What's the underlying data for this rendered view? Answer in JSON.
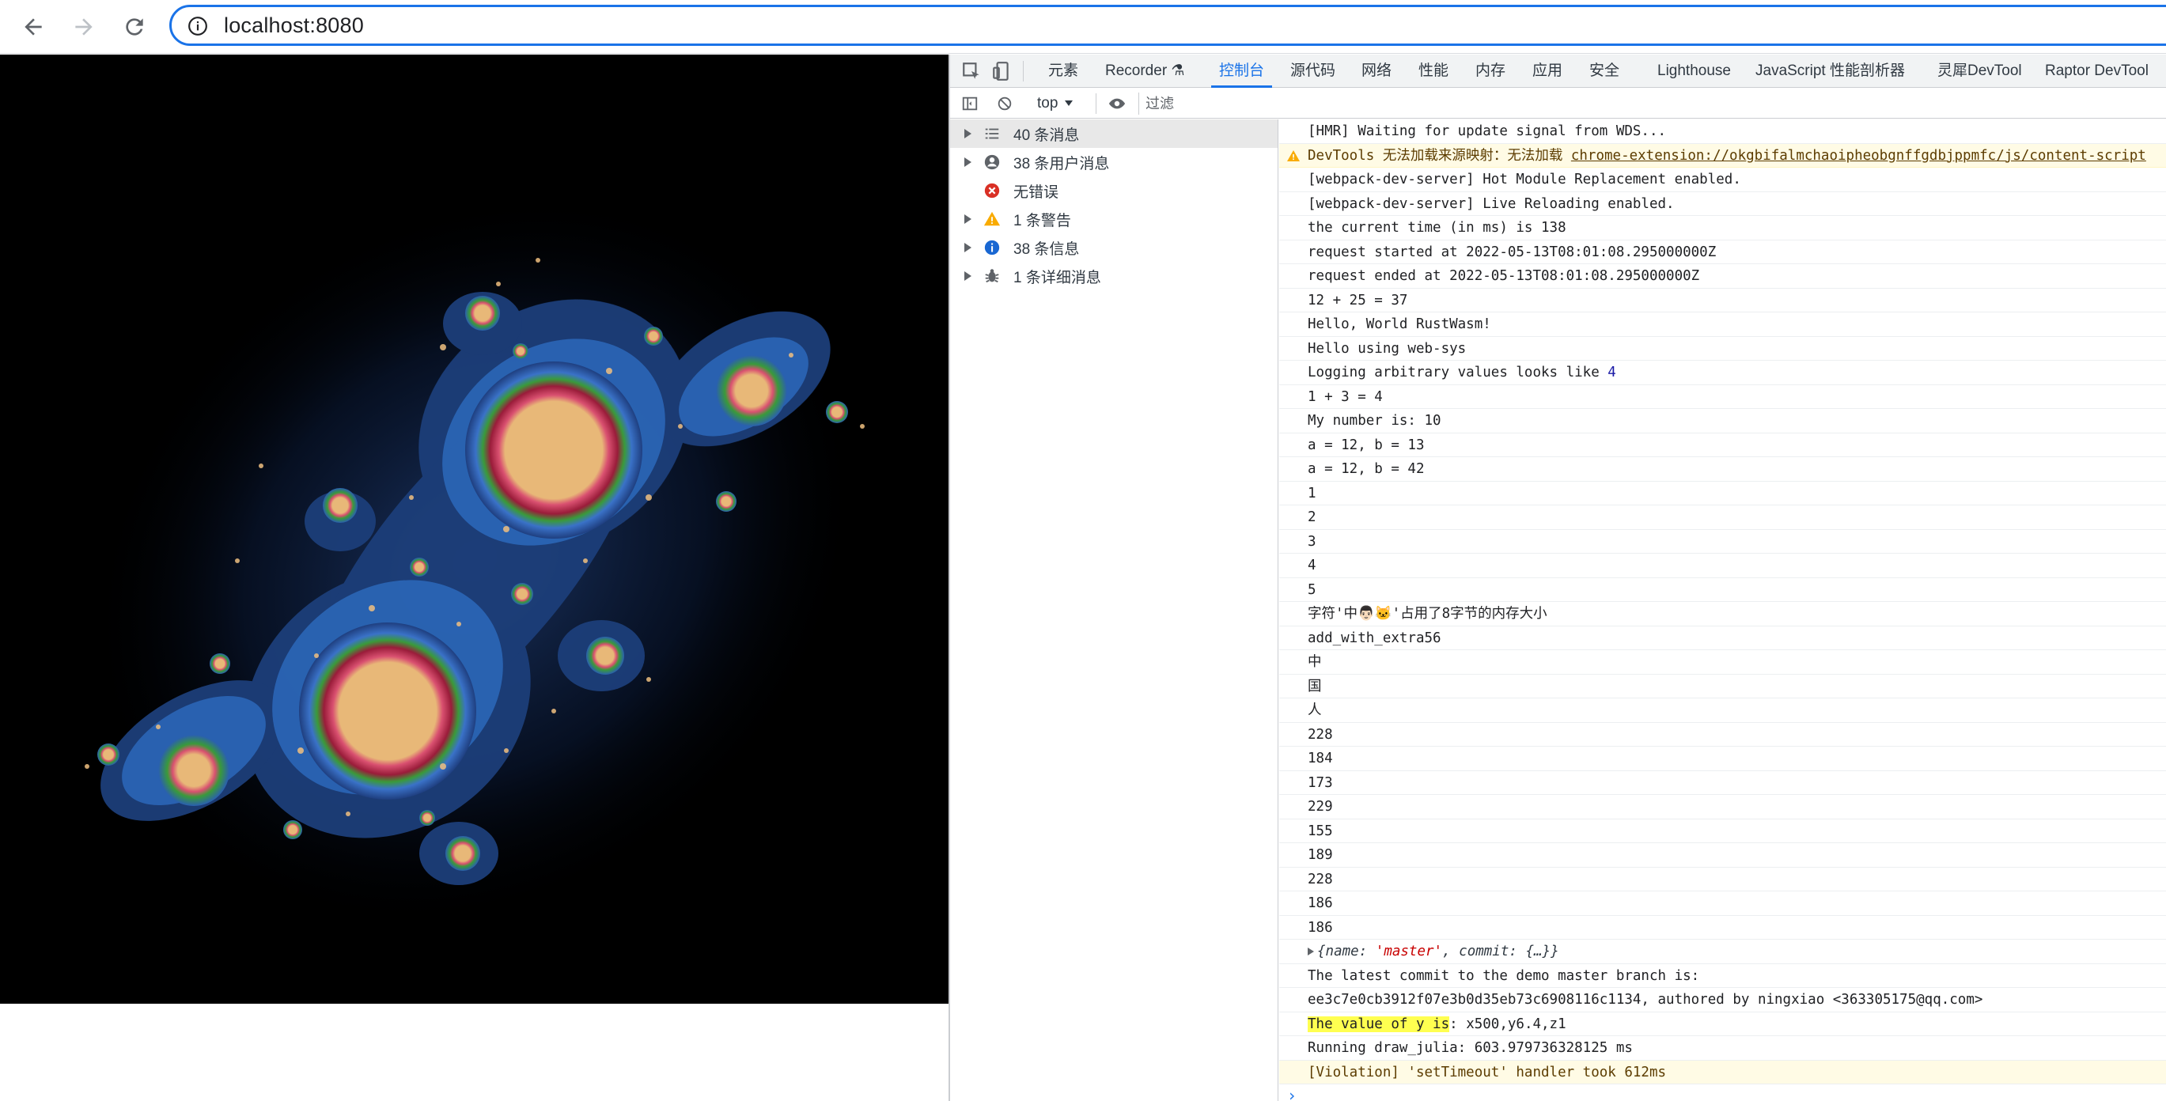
{
  "browser": {
    "url": "localhost:8080"
  },
  "devtools": {
    "tabs": [
      {
        "label": "元素"
      },
      {
        "label": "Recorder ⚗"
      },
      {
        "label": "控制台"
      },
      {
        "label": "源代码"
      },
      {
        "label": "网络"
      },
      {
        "label": "性能"
      },
      {
        "label": "内存"
      },
      {
        "label": "应用"
      },
      {
        "label": "安全"
      },
      {
        "label": "Lighthouse"
      },
      {
        "label": "JavaScript 性能剖析器"
      },
      {
        "label": "灵犀DevTool"
      },
      {
        "label": "Raptor DevTool"
      }
    ],
    "active_tab": "控制台",
    "console_bar": {
      "context": "top",
      "filter_placeholder": "过滤"
    },
    "sidebar": [
      {
        "label": "40 条消息",
        "icon": "list-icon",
        "color": "#5f6368"
      },
      {
        "label": "38 条用户消息",
        "icon": "user-icon",
        "color": "#5f6368"
      },
      {
        "label": "无错误",
        "icon": "error-icon",
        "color": "#d93025"
      },
      {
        "label": "1 条警告",
        "icon": "warning-icon",
        "color": "#f9ab00"
      },
      {
        "label": "38 条信息",
        "icon": "info-icon",
        "color": "#1967d2"
      },
      {
        "label": "1 条详细消息",
        "icon": "bug-icon",
        "color": "#5f6368"
      }
    ],
    "log": [
      {
        "text": "[HMR] Waiting for update signal from WDS..."
      },
      {
        "text": "DevTools 无法加载来源映射：无法加载 ",
        "link": "chrome-extension://okgbifalmchaoipheobgnffgdbjppmfc/js/content-script",
        "level": "warning"
      },
      {
        "text": "[webpack-dev-server] Hot Module Replacement enabled."
      },
      {
        "text": "[webpack-dev-server] Live Reloading enabled."
      },
      {
        "text": "the current time (in ms) is 138"
      },
      {
        "text": "request started at 2022-05-13T08:01:08.295000000Z"
      },
      {
        "text": "request ended at 2022-05-13T08:01:08.295000000Z"
      },
      {
        "text": "12 + 25 = 37"
      },
      {
        "text": "Hello, World RustWasm!"
      },
      {
        "text": "Hello using web-sys"
      },
      {
        "text": "Logging arbitrary values looks like ",
        "num": "4"
      },
      {
        "text": "1 + 3 = 4"
      },
      {
        "text": "My number is: 10"
      },
      {
        "text": "a = 12, b = 13"
      },
      {
        "text": "a = 12, b = 42"
      },
      {
        "text": "1"
      },
      {
        "text": "2"
      },
      {
        "text": "3"
      },
      {
        "text": "4"
      },
      {
        "text": "5"
      },
      {
        "text": "字符'中👨🏻🐱'占用了8字节的内存大小"
      },
      {
        "text": "add_with_extra56"
      },
      {
        "text": "中"
      },
      {
        "text": "国"
      },
      {
        "text": "人"
      },
      {
        "text": "228"
      },
      {
        "text": "184"
      },
      {
        "text": "173"
      },
      {
        "text": "229"
      },
      {
        "text": "155"
      },
      {
        "text": "189"
      },
      {
        "text": "228"
      },
      {
        "text": "186"
      },
      {
        "text": "186"
      },
      {
        "object": true,
        "k1": "name",
        "v1": "'master'",
        "k2": "commit",
        "v2": "{…}"
      },
      {
        "text": "The latest commit to the demo master branch is:"
      },
      {
        "text": "ee3c7e0cb3912f07e3b0d35eb73c6908116c1134, authored by ningxiao <363305175@qq.com>"
      },
      {
        "highlight": "The value of y is",
        "text": ": x500,y6.4,z1"
      },
      {
        "text": "Running draw_julia: 603.979736328125 ms"
      },
      {
        "text": "[Violation] 'setTimeout' handler took 612ms",
        "level": "violation"
      }
    ],
    "prompt_symbol": "›"
  }
}
